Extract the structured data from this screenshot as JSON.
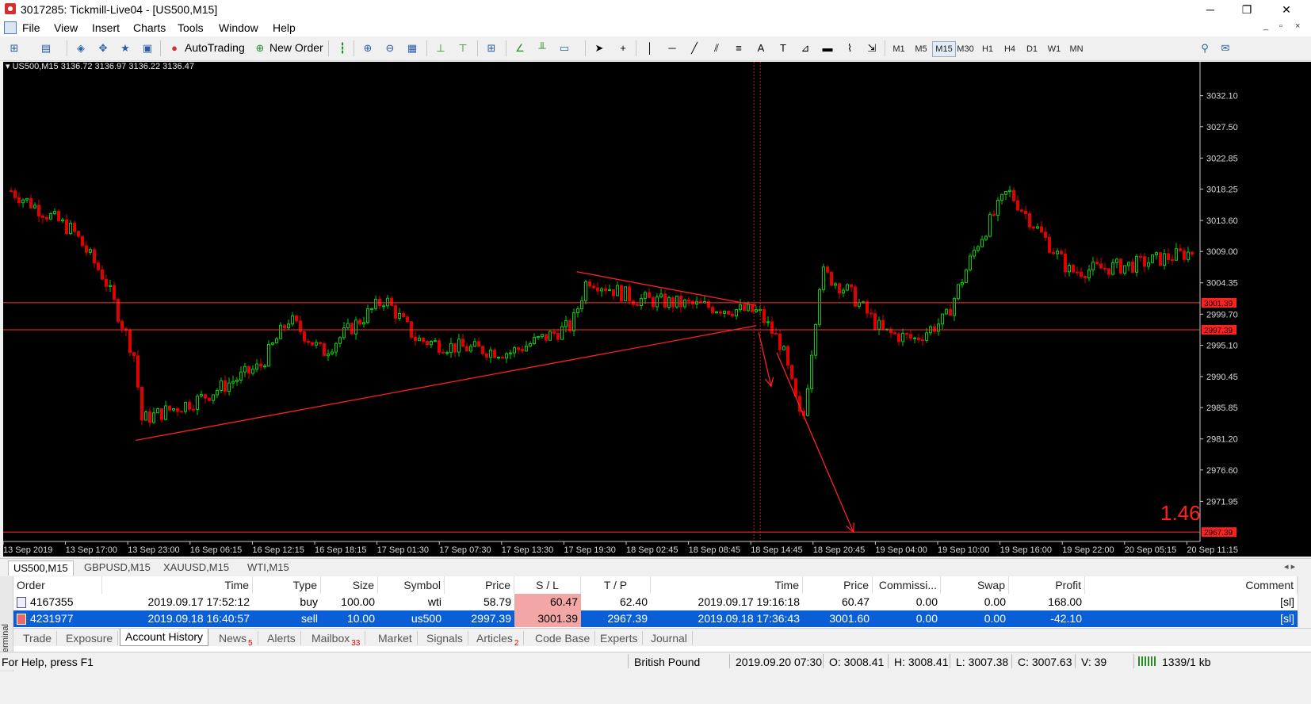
{
  "window": {
    "title": "3017285: Tickmill-Live04 - [US500,M15]",
    "controls": [
      "─",
      "❐",
      "✕"
    ],
    "mdi_controls": [
      "_",
      "▫",
      "×"
    ]
  },
  "menu": [
    "File",
    "View",
    "Insert",
    "Charts",
    "Tools",
    "Window",
    "Help"
  ],
  "toolbar": {
    "autotrading_label": "AutoTrading",
    "new_order_label": "New Order",
    "text_tool_label": "A",
    "timeframes": [
      "M1",
      "M5",
      "M15",
      "M30",
      "H1",
      "H4",
      "D1",
      "W1",
      "MN"
    ],
    "selected_timeframe": "M15"
  },
  "chart": {
    "header": "US500,M15  3136.72 3136.97 3136.22 3136.47",
    "big_label": "1.46",
    "price_labels": [
      "3032.10",
      "3027.50",
      "3022.85",
      "3018.25",
      "3013.60",
      "3009.00",
      "3004.35",
      "2999.70",
      "2995.10",
      "2990.45",
      "2985.85",
      "2981.20",
      "2976.60",
      "2971.95"
    ],
    "hline_labels": [
      "3001.39",
      "2997.39",
      "2967.39"
    ],
    "time_labels": [
      "13 Sep 2019",
      "13 Sep 17:00",
      "13 Sep 23:00",
      "16 Sep 06:15",
      "16 Sep 12:15",
      "16 Sep 18:15",
      "17 Sep 01:30",
      "17 Sep 07:30",
      "17 Sep 13:30",
      "17 Sep 19:30",
      "18 Sep 02:45",
      "18 Sep 08:45",
      "18 Sep 14:45",
      "18 Sep 20:45",
      "19 Sep 04:00",
      "19 Sep 10:00",
      "19 Sep 16:00",
      "19 Sep 22:00",
      "20 Sep 05:15",
      "20 Sep 11:15"
    ],
    "colors": {
      "bull": "#00d000",
      "bear": "#e00000",
      "bg": "#000000",
      "grid_line": "#ff3030"
    }
  },
  "chart_data": {
    "type": "candlestick",
    "title": "US500,M15",
    "ylim": [
      2967.0,
      3035.0
    ],
    "close_path": [
      {
        "t": "13 Sep 2019",
        "p": 3018
      },
      {
        "t": "13 Sep 17:00",
        "p": 3012
      },
      {
        "t": "13 Sep 20:00",
        "p": 3005
      },
      {
        "t": "13 Sep 23:00",
        "p": 2993
      },
      {
        "t": "13 Sep 23:30",
        "p": 2984
      },
      {
        "t": "16 Sep 06:15",
        "p": 2987
      },
      {
        "t": "16 Sep 12:15",
        "p": 2992
      },
      {
        "t": "16 Sep 15:00",
        "p": 2999
      },
      {
        "t": "16 Sep 18:15",
        "p": 2994
      },
      {
        "t": "17 Sep 01:30",
        "p": 3002
      },
      {
        "t": "17 Sep 04:30",
        "p": 2996
      },
      {
        "t": "17 Sep 07:30",
        "p": 2995
      },
      {
        "t": "17 Sep 13:30",
        "p": 2994
      },
      {
        "t": "17 Sep 19:30",
        "p": 2998
      },
      {
        "t": "17 Sep 21:00",
        "p": 3005
      },
      {
        "t": "18 Sep 02:45",
        "p": 3002
      },
      {
        "t": "18 Sep 08:45",
        "p": 3001
      },
      {
        "t": "18 Sep 14:45",
        "p": 3000
      },
      {
        "t": "18 Sep 17:00",
        "p": 2995
      },
      {
        "t": "18 Sep 19:00",
        "p": 2983
      },
      {
        "t": "18 Sep 20:45",
        "p": 3006
      },
      {
        "t": "19 Sep 00:00",
        "p": 3003
      },
      {
        "t": "19 Sep 04:00",
        "p": 2997
      },
      {
        "t": "19 Sep 07:00",
        "p": 2996
      },
      {
        "t": "19 Sep 10:00",
        "p": 2999
      },
      {
        "t": "19 Sep 13:00",
        "p": 3010
      },
      {
        "t": "19 Sep 16:00",
        "p": 3018
      },
      {
        "t": "19 Sep 19:00",
        "p": 3012
      },
      {
        "t": "19 Sep 22:00",
        "p": 3006
      },
      {
        "t": "20 Sep 05:15",
        "p": 3007
      },
      {
        "t": "20 Sep 11:15",
        "p": 3009
      }
    ],
    "horizontal_levels": [
      3001.39,
      2997.39,
      2967.39
    ],
    "trendlines": [
      {
        "from": {
          "t": "13 Sep 23:00",
          "p": 2981
        },
        "to": {
          "t": "18 Sep 14:30",
          "p": 2998
        }
      },
      {
        "from": {
          "t": "17 Sep 20:00",
          "p": 3006
        },
        "to": {
          "t": "18 Sep 14:30",
          "p": 3001
        }
      }
    ],
    "arrows": [
      {
        "from": {
          "t": "18 Sep 14:45",
          "p": 2997
        },
        "to": {
          "t": "18 Sep 16:00",
          "p": 2989
        }
      },
      {
        "from": {
          "t": "18 Sep 16:30",
          "p": 2994
        },
        "to": {
          "t": "19 Sep 00:30",
          "p": 2967.4
        }
      }
    ]
  },
  "chart_tabs": [
    "US500,M15",
    "GBPUSD,M15",
    "XAUUSD,M15",
    "WTI,M15"
  ],
  "terminal": {
    "side_label": "Terminal",
    "columns": [
      "Order",
      "Time",
      "Type",
      "Size",
      "Symbol",
      "Price",
      "S / L",
      "T / P",
      "Time",
      "Price",
      "Commissi...",
      "Swap",
      "Profit",
      "Comment"
    ],
    "rows": [
      {
        "order": "4167355",
        "time": "2019.09.17 17:52:12",
        "type": "buy",
        "size": "100.00",
        "symbol": "wti",
        "price": "58.79",
        "sl": "60.47",
        "tp": "62.40",
        "close_time": "2019.09.17 19:16:18",
        "close_price": "60.47",
        "commission": "0.00",
        "swap": "0.00",
        "profit": "168.00",
        "comment": "[sl]"
      },
      {
        "order": "4231977",
        "time": "2019.09.18 16:40:57",
        "type": "sell",
        "size": "10.00",
        "symbol": "us500",
        "price": "2997.39",
        "sl": "3001.39",
        "tp": "2967.39",
        "close_time": "2019.09.18 17:36:43",
        "close_price": "3001.60",
        "commission": "0.00",
        "swap": "0.00",
        "profit": "-42.10",
        "comment": "[sl]"
      }
    ],
    "tabs": [
      {
        "label": "Trade",
        "badge": ""
      },
      {
        "label": "Exposure",
        "badge": ""
      },
      {
        "label": "Account History",
        "badge": ""
      },
      {
        "label": "News",
        "badge": "5"
      },
      {
        "label": "Alerts",
        "badge": ""
      },
      {
        "label": "Mailbox",
        "badge": "33"
      },
      {
        "label": "Market",
        "badge": ""
      },
      {
        "label": "Signals",
        "badge": ""
      },
      {
        "label": "Articles",
        "badge": "2"
      },
      {
        "label": "Code Base",
        "badge": ""
      },
      {
        "label": "Experts",
        "badge": ""
      },
      {
        "label": "Journal",
        "badge": ""
      }
    ],
    "selected_tab": "Account History"
  },
  "statusbar": {
    "help": "For Help, press F1",
    "profile": "British Pound",
    "datetime": "2019.09.20 07:30",
    "open": "O: 3008.41",
    "high": "H: 3008.41",
    "low": "L: 3007.38",
    "close": "C: 3007.63",
    "volume": "V: 39",
    "traffic": "1339/1 kb"
  }
}
